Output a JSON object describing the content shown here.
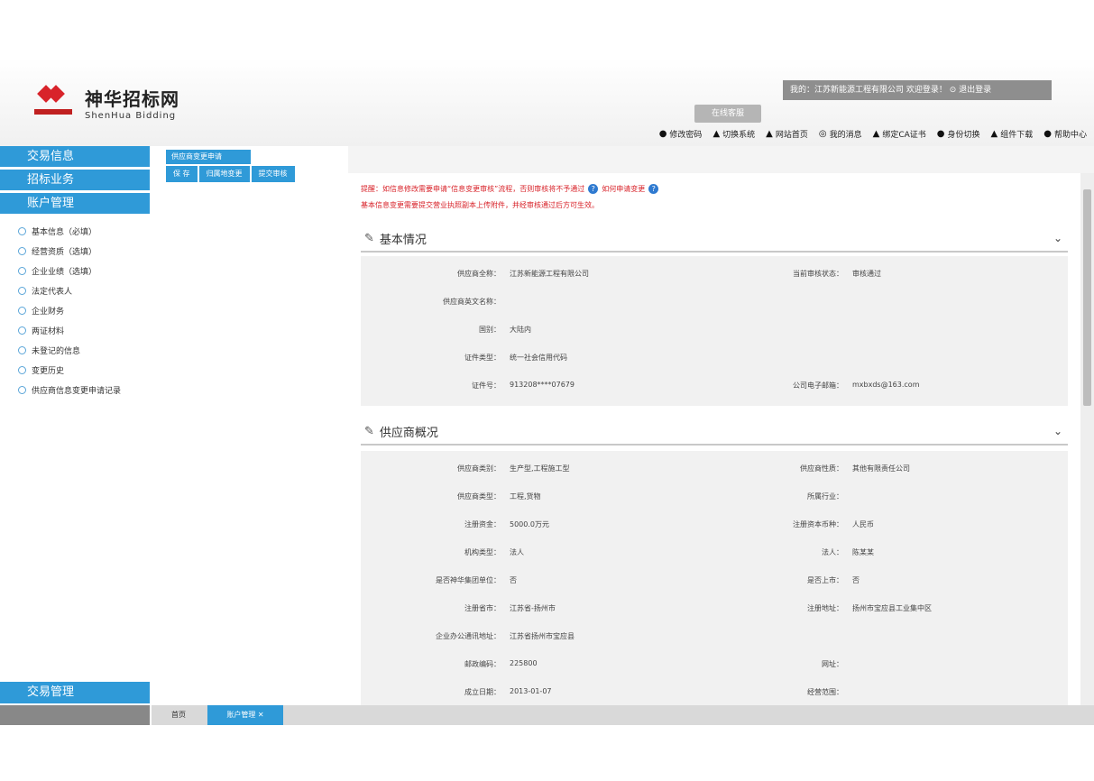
{
  "header": {
    "logo_cn": "神华招标网",
    "logo_en": "ShenHua Bidding",
    "user_bar": "我的：江苏新能源工程有限公司  欢迎登录！  ⊙ 退出登录",
    "online_service": "在线客服",
    "nav": [
      {
        "icon": "●",
        "label": "修改密码"
      },
      {
        "icon": "▲",
        "label": "切换系统"
      },
      {
        "icon": "▲",
        "label": "网站首页"
      },
      {
        "icon": "◎",
        "label": "我的消息"
      },
      {
        "icon": "▲",
        "label": "绑定CA证书"
      },
      {
        "icon": "●",
        "label": "身份切换"
      },
      {
        "icon": "▲",
        "label": "组件下载"
      },
      {
        "icon": "●",
        "label": "帮助中心"
      }
    ]
  },
  "sidebar": {
    "sections": [
      "交易信息",
      "招标业务",
      "账户管理"
    ],
    "items": [
      "基本信息（必填）",
      "经营资质（选填）",
      "企业业绩（选填）",
      "法定代表人",
      "企业财务",
      "两证材料",
      "未登记的信息",
      "变更历史",
      "供应商信息变更申请记录"
    ],
    "bottom_section": "交易管理"
  },
  "subpanel": {
    "tab": "供应商变更申请",
    "buttons": [
      "保 存",
      "归属地变更",
      "提交审核"
    ]
  },
  "notice": {
    "line1": "提醒：如信息修改需要申请“信息变更审核”流程，否则审核将不予通过",
    "help": "如何申请变更",
    "line2": "基本信息变更需要提交营业执照副本上传附件，并经审核通过后方可生效。"
  },
  "section1": {
    "title": "基本情况",
    "fields": [
      {
        "label": "供应商全称：",
        "value": "江苏新能源工程有限公司",
        "label2": "当前审核状态：",
        "value2": "审核通过"
      },
      {
        "label": "供应商英文名称：",
        "value": "",
        "label2": "",
        "value2": ""
      },
      {
        "label": "国别：",
        "value": "大陆内",
        "label2": "",
        "value2": ""
      },
      {
        "label": "证件类型：",
        "value": "统一社会信用代码",
        "label2": "",
        "value2": ""
      },
      {
        "label": "证件号：",
        "value": "913208****07679",
        "label2": "公司电子邮箱：",
        "value2": "mxbxds@163.com"
      }
    ]
  },
  "section2": {
    "title": "供应商概况",
    "fields": [
      {
        "label": "供应商类别：",
        "value": "生产型,工程施工型",
        "label2": "供应商性质：",
        "value2": "其他有限责任公司"
      },
      {
        "label": "供应商类型：",
        "value": "工程,货物",
        "label2": "所属行业：",
        "value2": ""
      },
      {
        "label": "注册资金：",
        "value": "5000.0万元",
        "label2": "注册资本币种：",
        "value2": "人民币"
      },
      {
        "label": "机构类型：",
        "value": "法人",
        "label2": "法人：",
        "value2": "陈某某"
      },
      {
        "label": "是否神华集团单位：",
        "value": "否",
        "label2": "是否上市：",
        "value2": "否"
      },
      {
        "label": "注册省市：",
        "value": "江苏省-扬州市",
        "label2": "注册地址：",
        "value2": "扬州市宝应县工业集中区"
      },
      {
        "label": "企业办公通讯地址：",
        "value": "江苏省扬州市宝应县",
        "label2": "",
        "value2": ""
      },
      {
        "label": "邮政编码：",
        "value": "225800",
        "label2": "网址：",
        "value2": ""
      },
      {
        "label": "成立日期：",
        "value": "2013-01-07",
        "label2": "经营范围：",
        "value2": ""
      }
    ]
  },
  "statusbar": {
    "home": "首页",
    "active_tab": "账户管理 ✕"
  }
}
